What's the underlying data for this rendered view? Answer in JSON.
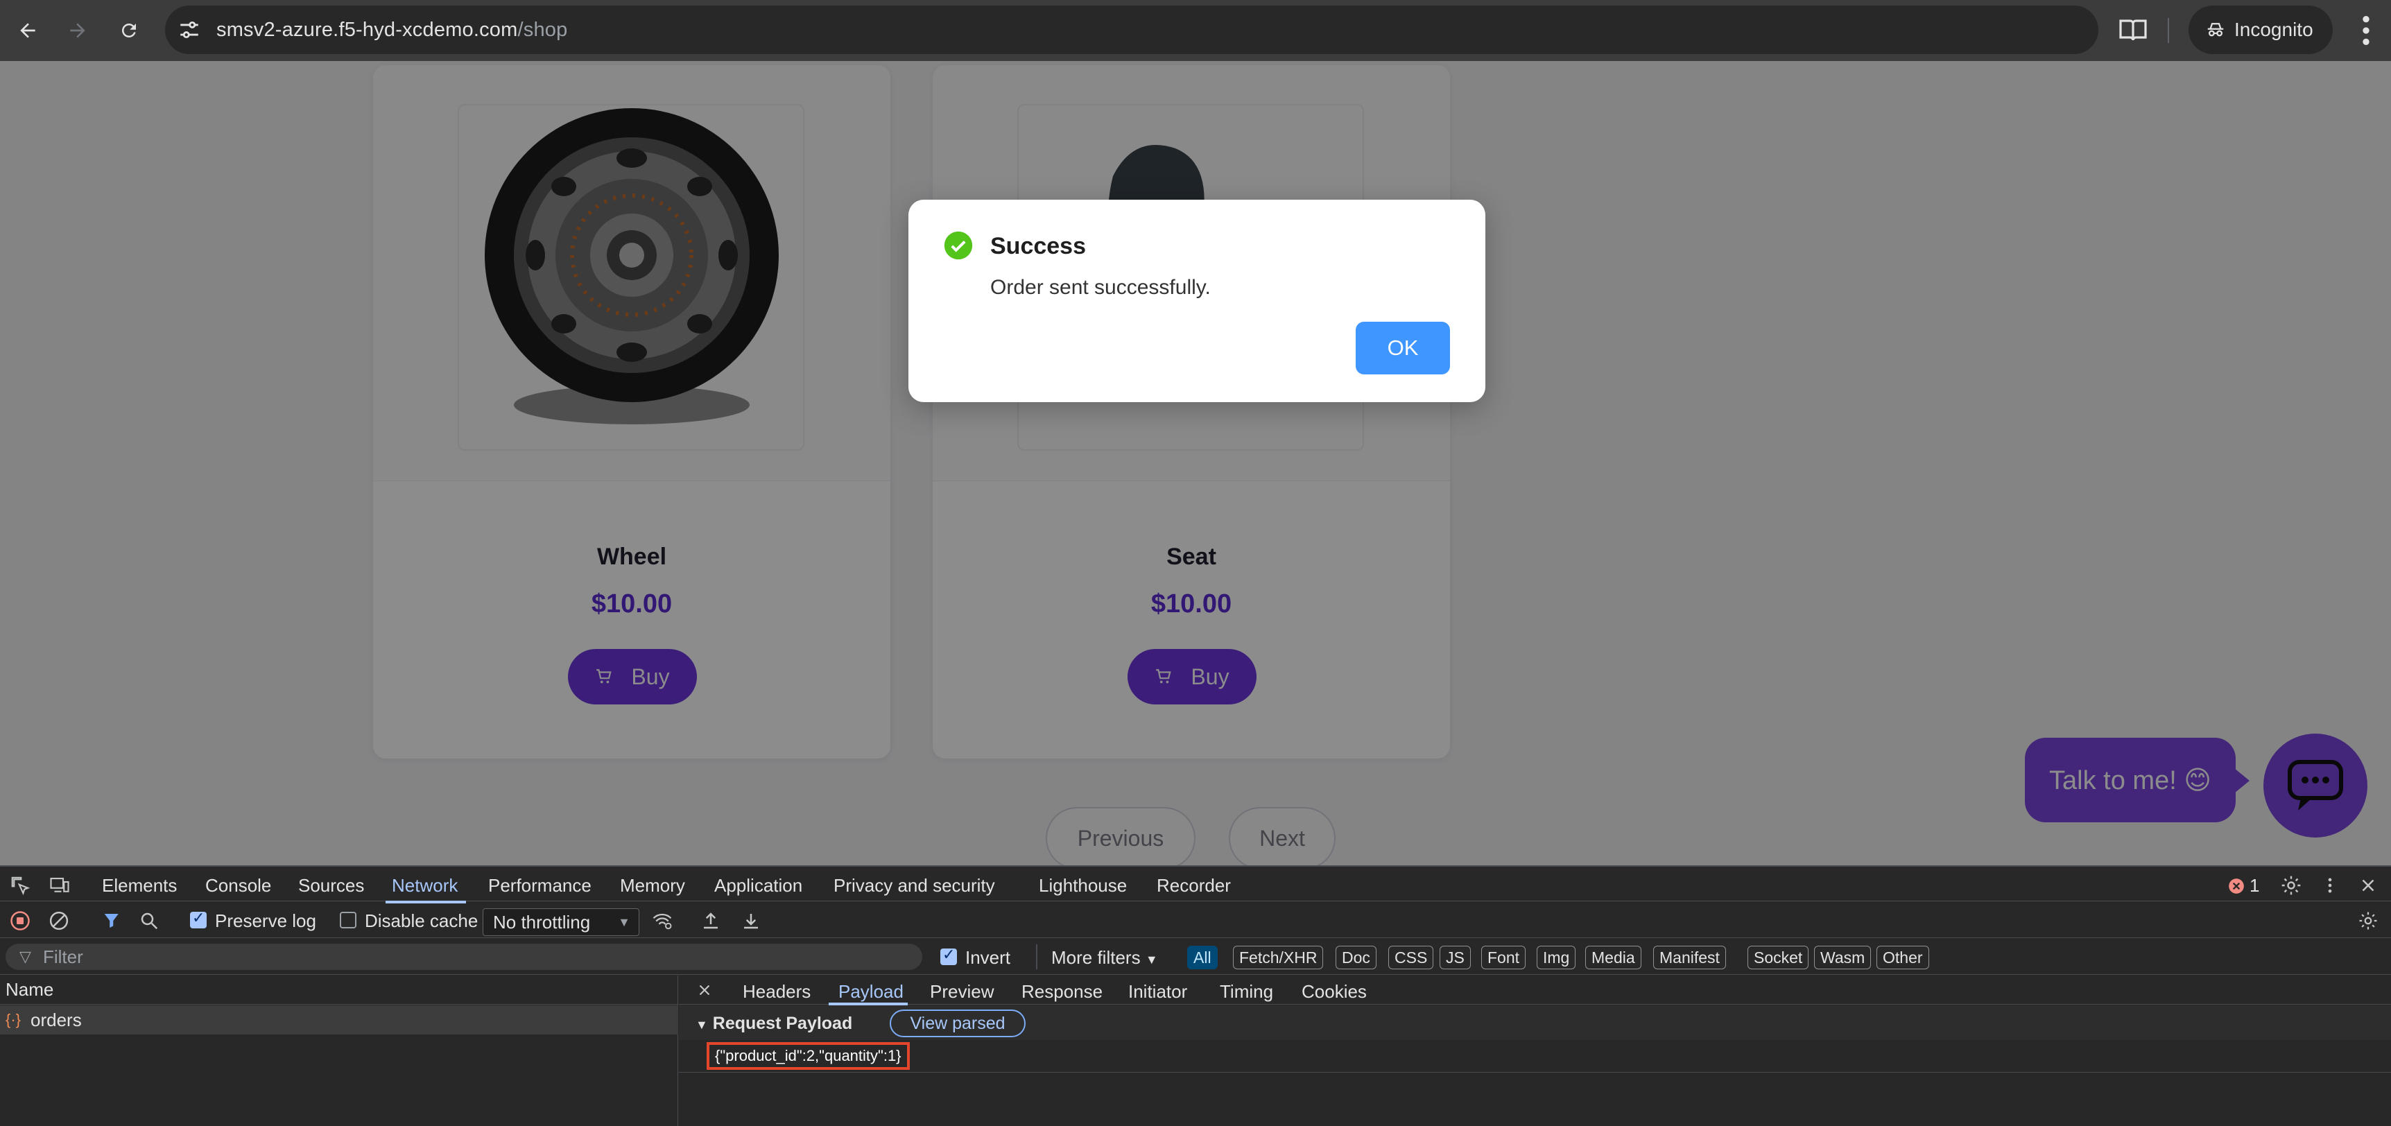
{
  "browser": {
    "url_host": "smsv2-azure.f5-hyd-xcdemo.com",
    "url_path": "/shop",
    "profile_label": "Incognito"
  },
  "shop": {
    "products": [
      {
        "name": "Wheel",
        "price": "$10.00",
        "buy_label": "Buy"
      },
      {
        "name": "Seat",
        "price": "$10.00",
        "buy_label": "Buy"
      }
    ],
    "pager": {
      "previous": "Previous",
      "next": "Next"
    },
    "chat_prompt": "Talk to me! 😊"
  },
  "modal": {
    "title": "Success",
    "message": "Order sent successfully.",
    "ok_label": "OK",
    "icon": "check-circle-icon",
    "accent": "#52c41a"
  },
  "devtools": {
    "tabs": [
      "Elements",
      "Console",
      "Sources",
      "Network",
      "Performance",
      "Memory",
      "Application",
      "Privacy and security",
      "Lighthouse",
      "Recorder"
    ],
    "active_tab": "Network",
    "error_count": "1",
    "toolbar": {
      "preserve_log": "Preserve log",
      "disable_cache": "Disable cache",
      "throttling": "No throttling"
    },
    "filter": {
      "placeholder": "Filter",
      "invert": "Invert",
      "more_filters": "More filters",
      "types": [
        "All",
        "Fetch/XHR",
        "Doc",
        "CSS",
        "JS",
        "Font",
        "Img",
        "Media",
        "Manifest",
        "Socket",
        "Wasm",
        "Other"
      ]
    },
    "requests": {
      "name_header": "Name",
      "items": [
        "orders"
      ]
    },
    "detail": {
      "tabs": [
        "Headers",
        "Payload",
        "Preview",
        "Response",
        "Initiator",
        "Timing",
        "Cookies"
      ],
      "active_tab": "Payload",
      "section_title": "Request Payload",
      "view_parsed": "View parsed",
      "payload": "{\"product_id\":2,\"quantity\":1}"
    }
  }
}
